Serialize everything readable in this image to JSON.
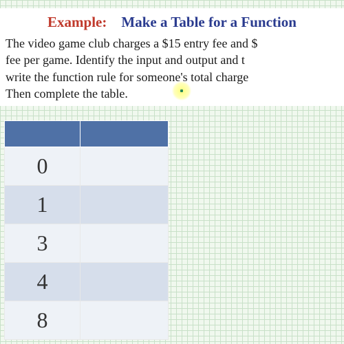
{
  "heading": {
    "example_label": "Example:",
    "title": "Make a Table for a Function"
  },
  "problem": {
    "line1": "The video game club charges a $15 entry fee and $",
    "line2": "fee per game.   Identify the input and output and t",
    "line3": "write the function rule for someone's total charge",
    "line4": "Then complete the table."
  },
  "table": {
    "headers": [
      "",
      ""
    ],
    "rows": [
      [
        "0",
        ""
      ],
      [
        "1",
        ""
      ],
      [
        "3",
        ""
      ],
      [
        "4",
        ""
      ],
      [
        "8",
        ""
      ]
    ]
  }
}
